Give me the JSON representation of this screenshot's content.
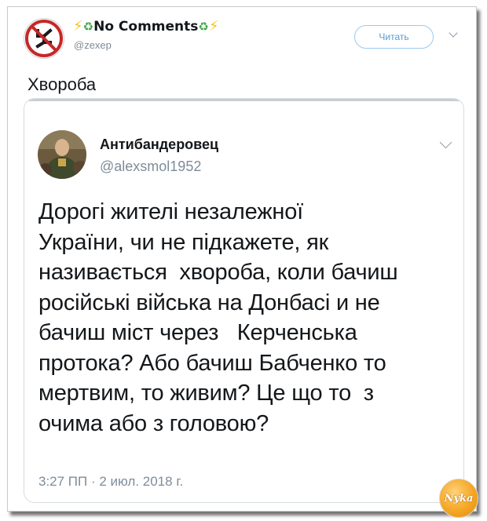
{
  "header": {
    "display_name_prefix": "⚡",
    "display_name_recycle_left": "♻",
    "display_name": "No Comments",
    "display_name_recycle_right": "♻",
    "display_name_suffix": "⚡",
    "handle": "@zexep",
    "follow_label": "Читать",
    "avatar_icon": "no-nazi-sign-icon",
    "menu_icon": "chevron-down-icon"
  },
  "tweet": {
    "text": "Хвороба"
  },
  "quoted_tweet": {
    "display_name": "Антибандеровец",
    "handle": "@alexsmol1952",
    "avatar_icon": "user-photo-avatar",
    "menu_icon": "chevron-down-icon",
    "lines": [
      "Дорогі жителі незалежної",
      "України, чи не підкажете, як",
      "називається  хвороба, коли бачиш",
      "російські війська на Донбасі и не",
      "бачиш міст через   Керченська",
      "протока? Або бачиш Бабченко то",
      "мертвим, то живим? Це що то  з",
      "очима або з головою?"
    ],
    "timestamp": "3:27 ПП · 2 июл. 2018 г."
  },
  "watermark": {
    "text": "Nyka",
    "color": "#f5a623"
  },
  "colors": {
    "link_blue": "#5d9bd3",
    "secondary_text": "#7e8c99",
    "primary_text": "#14171a"
  }
}
